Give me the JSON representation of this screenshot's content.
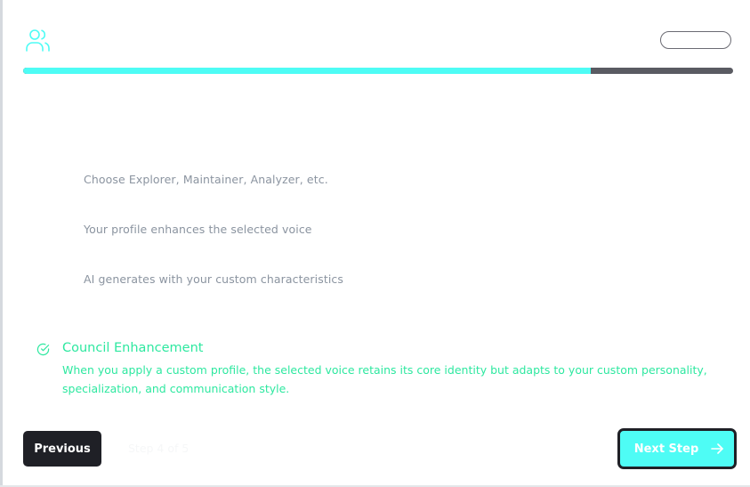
{
  "header": {
    "icon": "users-icon",
    "pill_label": ""
  },
  "progress": {
    "fraction": 0.8
  },
  "steps": [
    {
      "text": "Choose Explorer, Maintainer, Analyzer, etc."
    },
    {
      "text": "Your profile enhances the selected voice"
    },
    {
      "text": "AI generates with your custom characteristics"
    }
  ],
  "note": {
    "icon": "check-circle-icon",
    "title": "Council Enhancement",
    "body": "When you apply a custom profile, the selected voice retains its core identity but adapts to your custom personality, specialization, and communication style."
  },
  "footer": {
    "previous_label": "Previous",
    "ghost_label": "Step 4 of 5",
    "next_label": "Next Step",
    "next_icon": "arrow-right-icon"
  },
  "colors": {
    "accent": "#4efcf5",
    "success": "#2ee8a0",
    "dark": "#1f2026",
    "muted_text": "#8b94a0",
    "track": "#5a5b62"
  }
}
